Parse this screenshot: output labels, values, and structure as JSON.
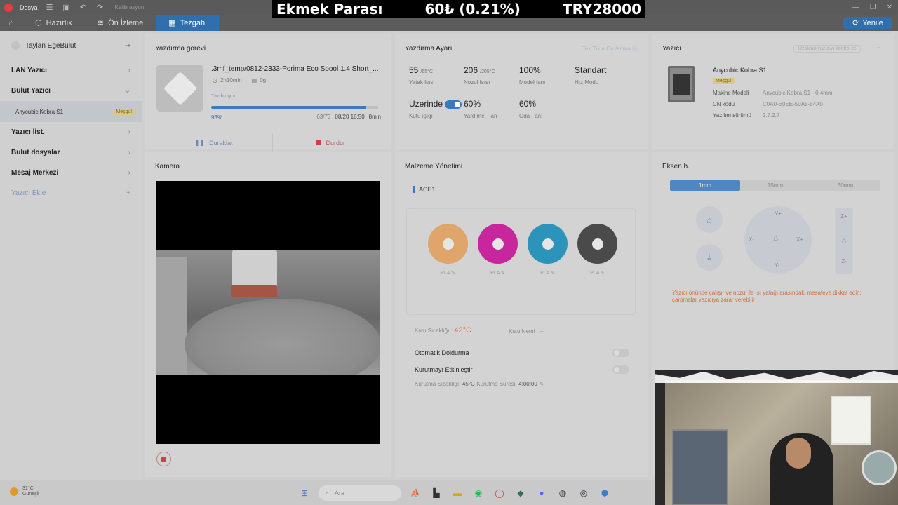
{
  "titlebar": {
    "file_label": "Dosya",
    "calibration_label": "Kalibrasyon"
  },
  "overlay": {
    "left": "Ekmek Parası",
    "center": "60₺ (0.21%)",
    "right": "TRY28000"
  },
  "nav": {
    "tabs": [
      {
        "label": "Hazırlık",
        "icon": "cube-icon"
      },
      {
        "label": "Ön İzleme",
        "icon": "layers-icon"
      },
      {
        "label": "Tezgah",
        "icon": "grid-icon"
      }
    ],
    "refresh_label": "Yenile"
  },
  "sidebar": {
    "user": "Taylan EgeBulut",
    "items": [
      {
        "label": "LAN Yazıcı"
      },
      {
        "label": "Bulut Yazıcı"
      },
      {
        "label": "Yazıcı list."
      },
      {
        "label": "Bulut dosyalar"
      },
      {
        "label": "Mesaj Merkezi"
      },
      {
        "label": "Yazıcı Ekle"
      }
    ],
    "cloud_printer": {
      "name": "Anycubic Kobra S1",
      "badge": "Meşgul"
    }
  },
  "job": {
    "title": "Yazdırma görevi",
    "file": ".3mf_temp/0812-2333-Porima Eco Spool 1.4 Short_...",
    "duration": "2h10min",
    "weight": "0g",
    "status": "Yazdırılıyor...",
    "progress_pct": "93%",
    "progress_value": 0.93,
    "layers": "63/73",
    "eta_date": "08/20 18:50",
    "remaining": "8min",
    "pause_label": "Duraklat",
    "stop_label": "Durdur"
  },
  "settings": {
    "title": "Yazdırma Ayarı",
    "link": "Tek Tıkla Ön Isıtma",
    "stats": [
      {
        "value": "55",
        "unit": "/55°C",
        "label": "Yatak Isısı"
      },
      {
        "value": "206",
        "unit": "/205°C",
        "label": "Nozul Isısı"
      },
      {
        "value": "100%",
        "unit": "",
        "label": "Model fanı"
      },
      {
        "value": "Standart",
        "unit": "",
        "label": "Hız Modu"
      },
      {
        "value": "Üzerinde",
        "unit": "",
        "label": "Kutu ışığı"
      },
      {
        "value": "60%",
        "unit": "",
        "label": "Yardımcı Fan"
      },
      {
        "value": "60%",
        "unit": "",
        "label": "Oda Fanı"
      }
    ]
  },
  "printer": {
    "title": "Yazıcı",
    "link": "Uzaktan yazıcıyı kontrol et",
    "name": "Anycubic Kobra S1",
    "badge": "Meşgul",
    "rows": [
      {
        "key": "Makine Modeli",
        "value": "Anycubic Kobra S1 - 0.4mm"
      },
      {
        "key": "CN kodu",
        "value": "C0A0-E0EE-50A5-54A0"
      },
      {
        "key": "Yazılım sürümü",
        "value": "2.7.2.7"
      }
    ]
  },
  "camera": {
    "title": "Kamera"
  },
  "material": {
    "title": "Malzeme Yönetimi",
    "unit": "ACE1",
    "spools": [
      {
        "color": "#dfa56a",
        "label": "PLA"
      },
      {
        "color": "#c8269c",
        "label": "PLA"
      },
      {
        "color": "#2c93ba",
        "label": "PLA"
      },
      {
        "color": "#4a4a4a",
        "label": "PLA"
      }
    ],
    "box_temp_label": "Kutu Sıcaklığı :",
    "box_temp": "42°C",
    "humidity_label": "Kutu Nemi :",
    "humidity": "--",
    "auto_fill": "Otomatik Doldurma",
    "dry_enable": "Kurutmayı Etkinleştir",
    "dry_temp_label": "Kurutma Sıcaklığı:",
    "dry_temp": "45°C",
    "dry_time_label": "Kurutma Süresi:",
    "dry_time": "4:00:00"
  },
  "axis": {
    "title": "Eksen h.",
    "steps": [
      "1mm",
      "15mm",
      "50mm"
    ],
    "pad": {
      "up": "Y+",
      "down": "Y-",
      "left": "X-",
      "right": "X+"
    },
    "z": {
      "up": "Z+",
      "down": "Z-"
    },
    "warning": "Yazıcı önünde çalışır ve nozul ile ısı yatağı arasındaki mesafeye dikkat edin; çarpmalar yazıcıya zarar verebilir"
  },
  "taskbar": {
    "temp": "31°C",
    "weather": "Güneşli",
    "search_placeholder": "Ara"
  }
}
